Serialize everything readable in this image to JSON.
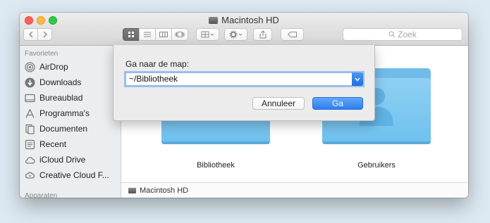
{
  "window": {
    "title": "Macintosh HD"
  },
  "toolbar": {
    "back_icon": "chevron-left-icon",
    "forward_icon": "chevron-right-icon",
    "view_icons": [
      "icon-view-icon",
      "list-view-icon",
      "column-view-icon",
      "cover-flow-icon"
    ],
    "arrange_icon": "arrange-icon",
    "action_icon": "gear-icon",
    "share_icon": "share-icon",
    "tags_icon": "tag-icon",
    "search_placeholder": "Zoek"
  },
  "sidebar": {
    "favorites_heading": "Favorieten",
    "items": [
      {
        "label": "AirDrop",
        "icon": "airdrop-icon"
      },
      {
        "label": "Downloads",
        "icon": "download-icon"
      },
      {
        "label": "Bureaublad",
        "icon": "desktop-icon"
      },
      {
        "label": "Programma's",
        "icon": "applications-icon"
      },
      {
        "label": "Documenten",
        "icon": "documents-icon"
      },
      {
        "label": "Recent",
        "icon": "recent-icon"
      },
      {
        "label": "iCloud Drive",
        "icon": "cloud-icon"
      },
      {
        "label": "Creative Cloud F...",
        "icon": "creative-cloud-icon"
      }
    ],
    "devices_heading": "Apparaten"
  },
  "content": {
    "folders": [
      {
        "label": "Bibliotheek",
        "icon": "folder-icon"
      },
      {
        "label": "Gebruikers",
        "icon": "users-folder-icon"
      }
    ]
  },
  "pathbar": {
    "item": "Macintosh HD"
  },
  "goto_sheet": {
    "label": "Ga naar de map:",
    "path_value": "~/Bibliotheek",
    "cancel_label": "Annuleer",
    "go_label": "Ga"
  },
  "colors": {
    "accent": "#2a7ff0",
    "folder": "#71bce9"
  }
}
